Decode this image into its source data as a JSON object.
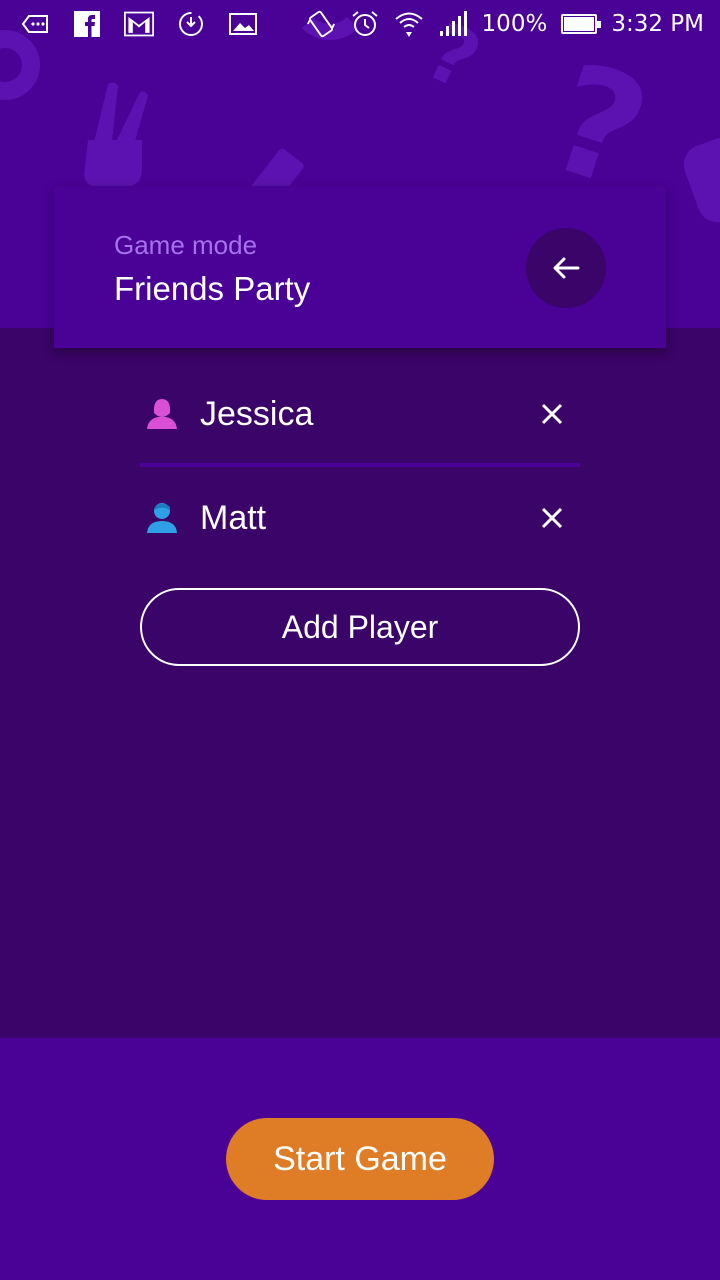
{
  "status_bar": {
    "left_icons": [
      "message-icon",
      "facebook-icon",
      "gmail-icon",
      "sync-icon",
      "image-icon"
    ],
    "right_icons": [
      "vibrate-icon",
      "alarm-icon",
      "wifi-icon",
      "signal-icon"
    ],
    "battery": "100%",
    "time": "3:32 PM"
  },
  "game_mode": {
    "label": "Game mode",
    "value": "Friends Party",
    "back_icon": "arrow-left-icon"
  },
  "players": [
    {
      "name": "Jessica",
      "icon": "female-user-icon",
      "icon_color": "#d94fd6"
    },
    {
      "name": "Matt",
      "icon": "male-user-icon",
      "icon_color": "#2f9fe6"
    }
  ],
  "actions": {
    "add_player": "Add Player",
    "start_game": "Start Game"
  },
  "colors": {
    "primary_purple": "#4a0196",
    "dark_purple": "#3a0468",
    "label_purple": "#a771ee",
    "start_orange": "#df7d27"
  }
}
